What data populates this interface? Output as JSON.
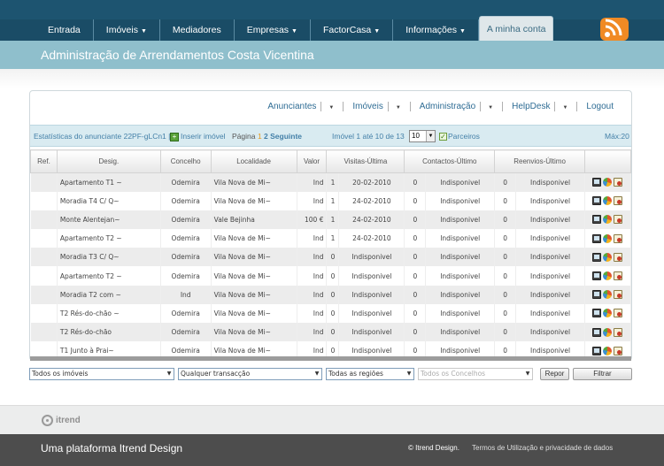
{
  "nav": {
    "items": [
      {
        "label": "Entrada",
        "dropdown": false
      },
      {
        "label": "Imóveis",
        "dropdown": true
      },
      {
        "label": "Mediadores",
        "dropdown": false
      },
      {
        "label": "Empresas",
        "dropdown": true
      },
      {
        "label": "FactorCasa",
        "dropdown": true
      },
      {
        "label": "Informações",
        "dropdown": true
      }
    ],
    "active_tab": "A minha conta",
    "rss_icon": "rss-icon"
  },
  "page_title": "Administração de Arrendamentos Costa Vicentina",
  "top_menu": [
    "Anunciantes",
    "Imóveis",
    "Administração",
    "HelpDesk",
    "Logout"
  ],
  "stats_bar": {
    "stats_text": "Estatísticas do anunciante 22PF-gLCn1 |",
    "insert_label": "Inserir imóvel",
    "page_label": "Página",
    "page_current": "1",
    "page_next": "2",
    "next_label": "Seguinte",
    "range_label": "Imóvel 1 até 10 de 13",
    "per_page_value": "10",
    "partners_label": "Parceiros",
    "max_label": "Máx:20"
  },
  "table": {
    "headers": [
      "Ref.",
      "Desig.",
      "Concelho",
      "Localidade",
      "Valor",
      "Visitas-Última",
      "Contactos-Último",
      "Reenvios-Último",
      ""
    ],
    "rows": [
      {
        "ref": "",
        "desig": "Apartamento T1 ~",
        "concelho": "Odemira",
        "localidade": "Vila Nova de Mi~",
        "valor": "Ind",
        "visitas": "1",
        "visitas_data": "20-02-2010",
        "contactos": "0",
        "contactos_data": "Indisponivel",
        "reenvios": "0",
        "reenvios_data": "Indisponivel"
      },
      {
        "ref": "",
        "desig": "Moradia T4 C/ Q~",
        "concelho": "Odemira",
        "localidade": "Vila Nova de Mi~",
        "valor": "Ind",
        "visitas": "1",
        "visitas_data": "24-02-2010",
        "contactos": "0",
        "contactos_data": "Indisponivel",
        "reenvios": "0",
        "reenvios_data": "Indisponivel"
      },
      {
        "ref": "",
        "desig": "Monte Alentejan~",
        "concelho": "Odemira",
        "localidade": "Vale Bejinha",
        "valor": "100 €",
        "visitas": "1",
        "visitas_data": "24-02-2010",
        "contactos": "0",
        "contactos_data": "Indisponivel",
        "reenvios": "0",
        "reenvios_data": "Indisponivel"
      },
      {
        "ref": "",
        "desig": "Apartamento T2 ~",
        "concelho": "Odemira",
        "localidade": "Vila Nova de Mi~",
        "valor": "Ind",
        "visitas": "1",
        "visitas_data": "24-02-2010",
        "contactos": "0",
        "contactos_data": "Indisponivel",
        "reenvios": "0",
        "reenvios_data": "Indisponivel"
      },
      {
        "ref": "",
        "desig": "Moradia T3 C/ Q~",
        "concelho": "Odemira",
        "localidade": "Vila Nova de Mi~",
        "valor": "Ind",
        "visitas": "0",
        "visitas_data": "Indisponivel",
        "contactos": "0",
        "contactos_data": "Indisponivel",
        "reenvios": "0",
        "reenvios_data": "Indisponivel"
      },
      {
        "ref": "",
        "desig": "Apartamento T2 ~",
        "concelho": "Odemira",
        "localidade": "Vila Nova de Mi~",
        "valor": "Ind",
        "visitas": "0",
        "visitas_data": "Indisponivel",
        "contactos": "0",
        "contactos_data": "Indisponivel",
        "reenvios": "0",
        "reenvios_data": "Indisponivel"
      },
      {
        "ref": "",
        "desig": "Moradia T2 com ~",
        "concelho": "Ind",
        "localidade": "Vila Nova de Mi~",
        "valor": "Ind",
        "visitas": "0",
        "visitas_data": "Indisponivel",
        "contactos": "0",
        "contactos_data": "Indisponivel",
        "reenvios": "0",
        "reenvios_data": "Indisponivel"
      },
      {
        "ref": "",
        "desig": "T2 Rés-do-chão ~",
        "concelho": "Odemira",
        "localidade": "Vila Nova de Mi~",
        "valor": "Ind",
        "visitas": "0",
        "visitas_data": "Indisponivel",
        "contactos": "0",
        "contactos_data": "Indisponivel",
        "reenvios": "0",
        "reenvios_data": "Indisponivel"
      },
      {
        "ref": "",
        "desig": "T2 Rés-do-chão",
        "concelho": "Odemira",
        "localidade": "Vila Nova de Mi~",
        "valor": "Ind",
        "visitas": "0",
        "visitas_data": "Indisponivel",
        "contactos": "0",
        "contactos_data": "Indisponivel",
        "reenvios": "0",
        "reenvios_data": "Indisponivel"
      },
      {
        "ref": "",
        "desig": "T1 Junto à Prai~",
        "concelho": "Odemira",
        "localidade": "Vila Nova de Mi~",
        "valor": "Ind",
        "visitas": "0",
        "visitas_data": "Indisponivel",
        "contactos": "0",
        "contactos_data": "Indisponivel",
        "reenvios": "0",
        "reenvios_data": "Indisponivel"
      }
    ],
    "row_action_icons": [
      "monitor-icon",
      "chart-icon",
      "document-icon"
    ]
  },
  "filters": {
    "property_type": "Todos os imóveis",
    "transaction": "Qualquer transacção",
    "region": "Todas as regiões",
    "council_placeholder": "Todos os Concelhos",
    "reset_label": "Repor",
    "filter_label": "Filtrar"
  },
  "footer": {
    "logo_text": "itrend",
    "brand": "Uma plataforma Itrend Design",
    "copyright": "© Itrend Design.",
    "terms": "Termos de Utilização e privacidade de dados"
  }
}
